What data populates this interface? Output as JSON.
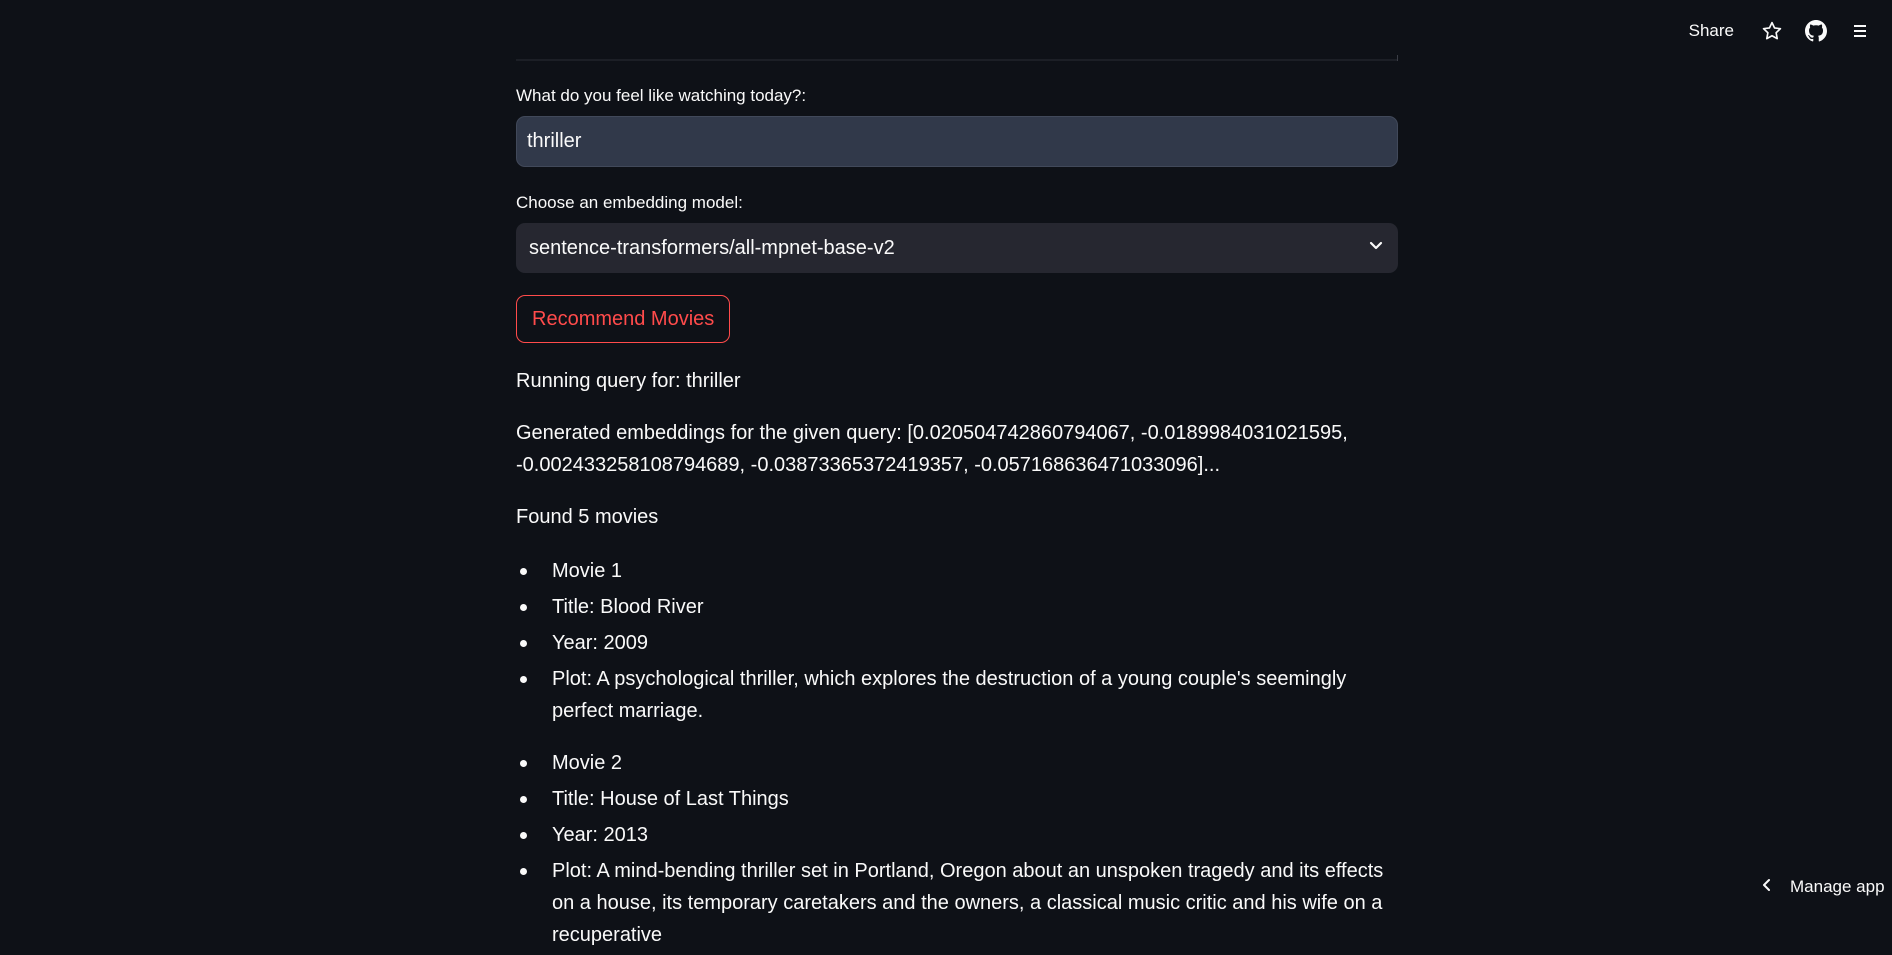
{
  "header": {
    "share_label": "Share",
    "icons": [
      "star-icon",
      "github-icon"
    ]
  },
  "form": {
    "query_label": "What do you feel like watching today?:",
    "query_value": "thriller",
    "model_label": "Choose an embedding model:",
    "model_selected": "sentence-transformers/all-mpnet-base-v2",
    "button_label": "Recommend Movies"
  },
  "output": {
    "running_query": "Running query for: thriller",
    "embeddings_line1": "Generated embeddings for the given query: [0.020504742860794067, -0.0189984031021595,",
    "embeddings_line2": "-0.002433258108794689, -0.03873365372419357, -0.057168636471033096]...",
    "found": "Found 5 movies"
  },
  "movies": [
    {
      "heading": "Movie 1",
      "title": "Title: Blood River",
      "year": "Year: 2009",
      "plot": "Plot: A psychological thriller, which explores the destruction of a young couple's seemingly perfect marriage."
    },
    {
      "heading": "Movie 2",
      "title": "Title: House of Last Things",
      "year": "Year: 2013",
      "plot": "Plot: A mind-bending thriller set in Portland, Oregon about an unspoken tragedy and its effects on a house, its temporary caretakers and the owners, a classical music critic and his wife on a recuperative"
    }
  ],
  "footer": {
    "manage_label": "Manage app"
  },
  "colors": {
    "background": "#0e1117",
    "input_bg": "#31394a",
    "select_bg": "#262730",
    "accent": "#ff4b4b",
    "text": "#fafafa"
  }
}
